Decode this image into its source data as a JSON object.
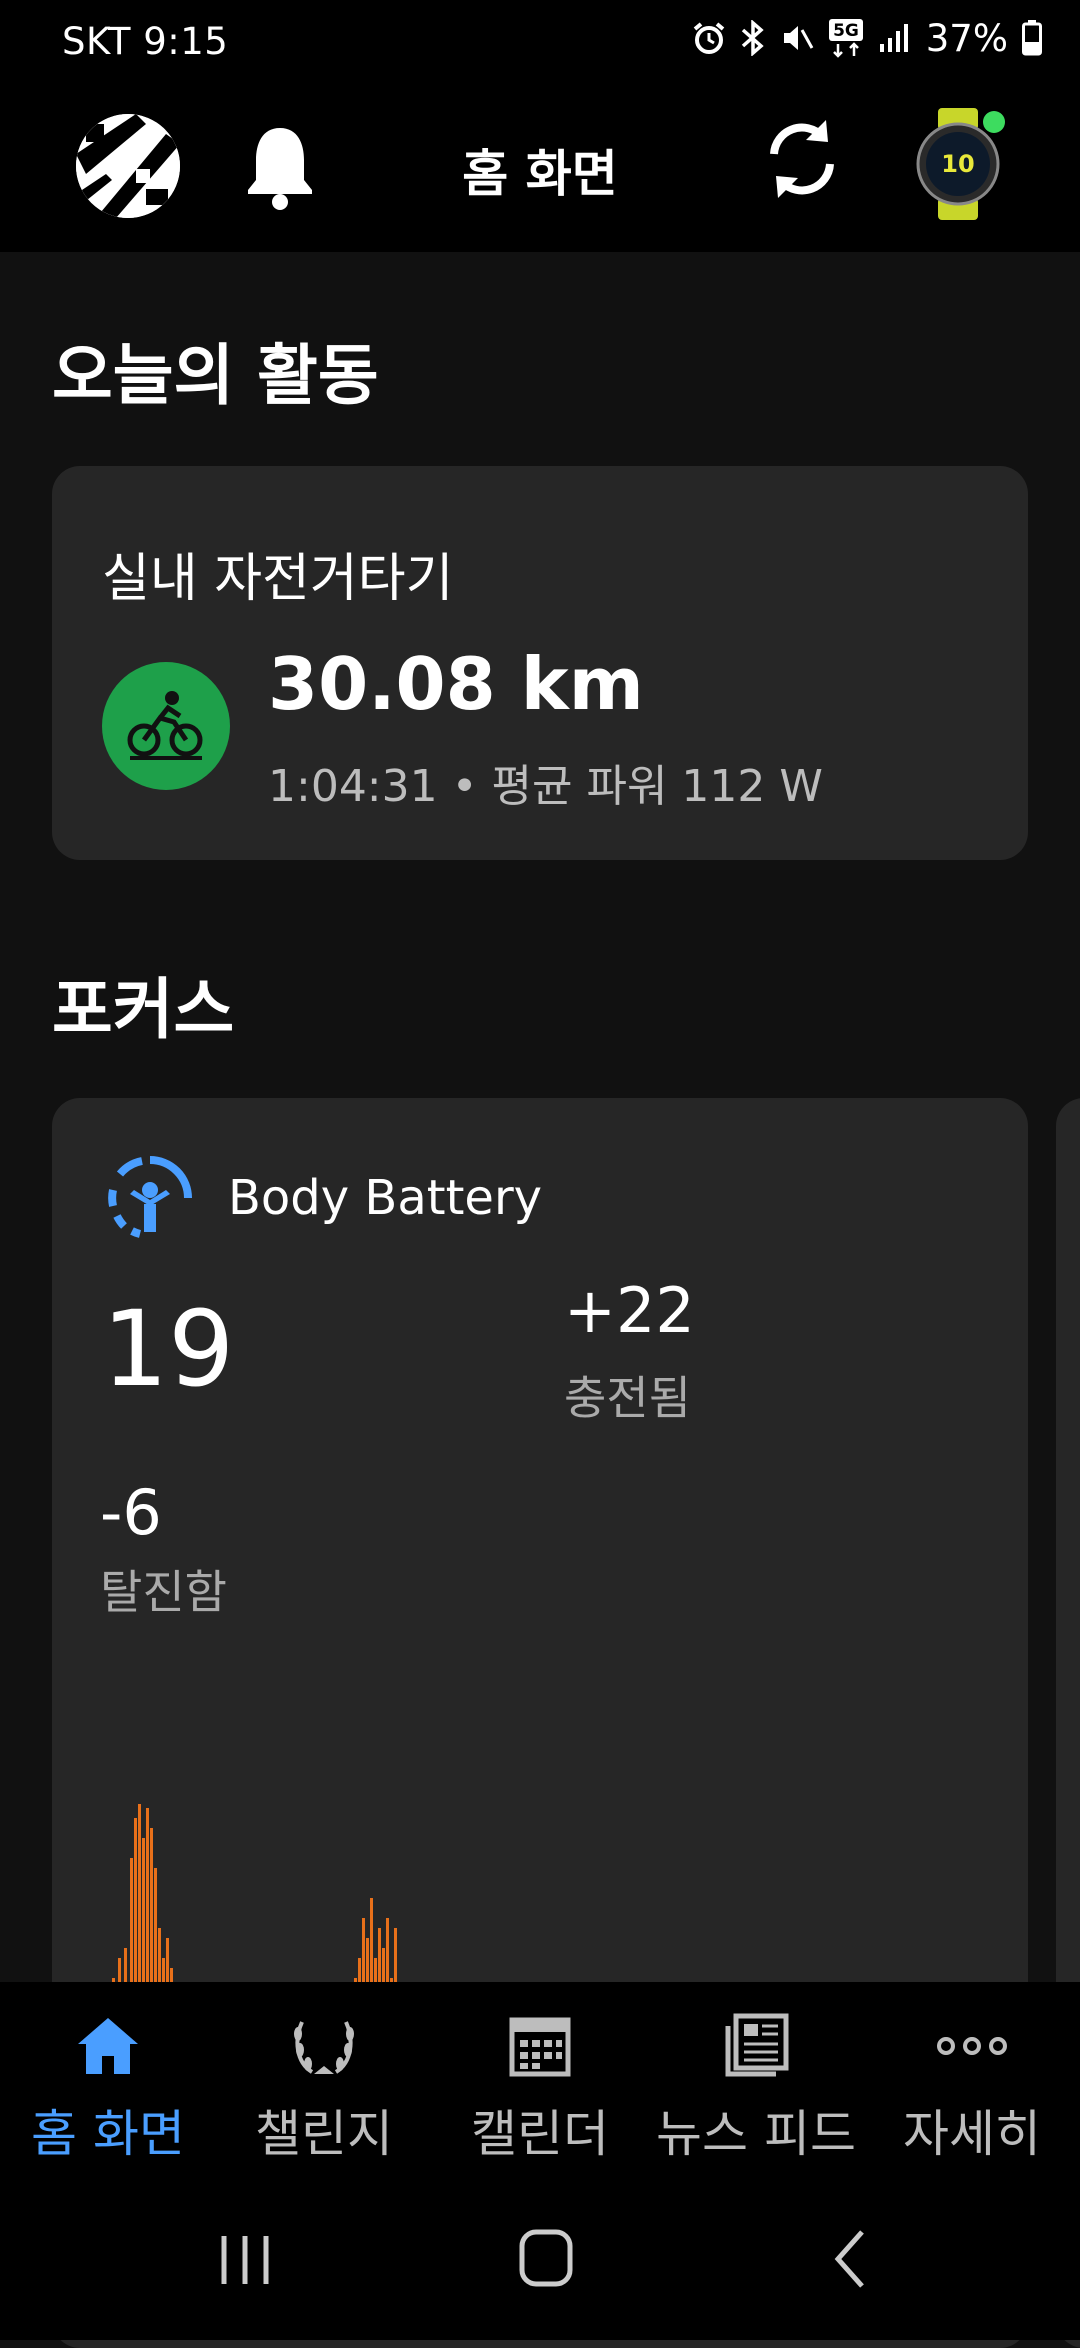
{
  "status_bar": {
    "carrier_time": "SKT 9:15",
    "battery": "37%",
    "network": "5G"
  },
  "header": {
    "title": "홈 화면",
    "icons": [
      "avatar",
      "bell-icon",
      "sync-icon",
      "watch-icon"
    ],
    "connection_color": "#3ddc5f"
  },
  "today": {
    "heading": "오늘의 활동",
    "activity": {
      "type": "실내 자전거타기",
      "distance": "30.08 km",
      "details": "1:04:31 • 평균 파워 112 W",
      "icon": "bike-icon",
      "icon_color": "#1ea04a"
    }
  },
  "focus": {
    "heading": "포커스",
    "body_battery": {
      "title": "Body Battery",
      "value": "19",
      "charged_value": "+22",
      "charged_label": "충전됨",
      "drained_value": "-6",
      "drained_label": "탈진함",
      "accent_color": "#4a9eff",
      "chart_color": "#e8701a"
    }
  },
  "bottom_nav": {
    "items": [
      {
        "label": "홈 화면",
        "icon": "home-icon",
        "active": true
      },
      {
        "label": "챌린지",
        "icon": "laurel-icon",
        "active": false
      },
      {
        "label": "캘린더",
        "icon": "calendar-icon",
        "active": false
      },
      {
        "label": "뉴스 피드",
        "icon": "news-icon",
        "active": false
      },
      {
        "label": "자세히",
        "icon": "more-icon",
        "active": false
      }
    ]
  },
  "system_nav": [
    "recents-button",
    "home-button",
    "back-button"
  ]
}
